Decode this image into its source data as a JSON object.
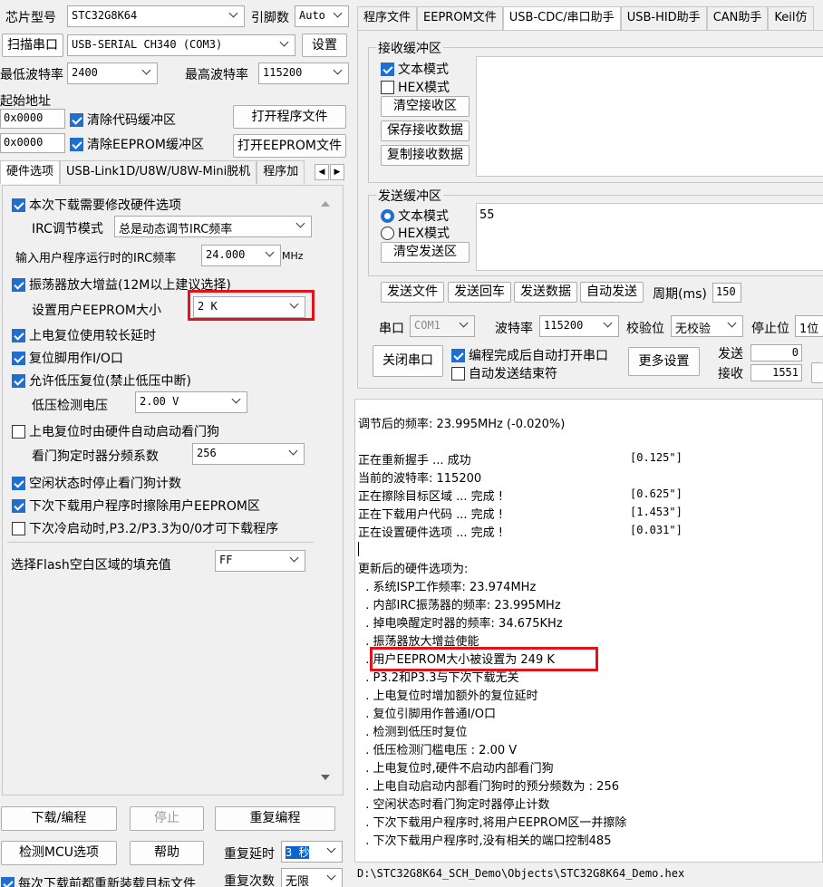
{
  "top": {
    "chip_label": "芯片型号",
    "chip_value": "STC32G8K64",
    "pin_label": "引脚数",
    "pin_value": "Auto",
    "scan_button": "扫描串口",
    "port_value": "USB-SERIAL CH340 (COM3)",
    "settings_button": "设置",
    "min_baud_label": "最低波特率",
    "min_baud_value": "2400",
    "max_baud_label": "最高波特率",
    "max_baud_value": "115200",
    "start_addr_label": "起始地址",
    "code_addr_value": "0x0000",
    "clear_code_label": "清除代码缓冲区",
    "open_program_button": "打开程序文件",
    "eeprom_addr_value": "0x0000",
    "clear_eeprom_label": "清除EEPROM缓冲区",
    "open_eeprom_button": "打开EEPROM文件"
  },
  "left_tabs": [
    "硬件选项",
    "USB-Link1D/U8W/U8W-Mini脱机",
    "程序加"
  ],
  "hw": {
    "opt1": "本次下载需要修改硬件选项",
    "irc_mode_label": "IRC调节模式",
    "irc_mode_value": "总是动态调节IRC频率",
    "irc_freq_label": "输入用户程序运行时的IRC频率",
    "irc_freq_value": "24.000",
    "irc_freq_unit": "MHz",
    "osc_gain": "振荡器放大增益(12M以上建议选择)",
    "eeprom_size_label": "设置用户EEPROM大小",
    "eeprom_size_value": "2   K",
    "power_delay": "上电复位使用较长延时",
    "reset_io": "复位脚用作I/O口",
    "lvr": "允许低压复位(禁止低压中断)",
    "lvd_label": "低压检测电压",
    "lvd_value": "2.00 V",
    "wdt_auto": "上电复位时由硬件自动启动看门狗",
    "wdt_div_label": "看门狗定时器分频系数",
    "wdt_div_value": "256",
    "idle_wdt": "空闲状态时停止看门狗计数",
    "erase_eeprom": "下次下载用户程序时擦除用户EEPROM区",
    "cold_boot": "下次冷启动时,P3.2/P3.3为0/0才可下载程序",
    "fill_label": "选择Flash空白区域的填充值",
    "fill_value": "FF"
  },
  "bottom_left": {
    "download_button": "下载/编程",
    "stop_button": "停止",
    "reprogram_button": "重复编程",
    "detect_button": "检测MCU选项",
    "help_button": "帮助",
    "repeat_delay_label": "重复延时",
    "repeat_delay_value": "3 秒",
    "repeat_count_label": "重复次数",
    "repeat_count_value": "无限",
    "reload_label": "每次下载前都重新装载目标文件"
  },
  "right_tabs": [
    "程序文件",
    "EEPROM文件",
    "USB-CDC/串口助手",
    "USB-HID助手",
    "CAN助手",
    "Keil仿"
  ],
  "serial": {
    "recv_group": "接收缓冲区",
    "recv_text_mode": "文本模式",
    "recv_hex_mode": "HEX模式",
    "clear_recv_button": "清空接收区",
    "save_recv_button": "保存接收数据",
    "copy_recv_button": "复制接收数据",
    "send_group": "发送缓冲区",
    "send_text_mode": "文本模式",
    "send_hex_mode": "HEX模式",
    "clear_send_button": "清空发送区",
    "send_content": "55",
    "send_file_button": "发送文件",
    "send_enter_button": "发送回车",
    "send_data_button": "发送数据",
    "auto_send_button": "自动发送",
    "period_label": "周期(ms)",
    "period_value": "150",
    "port_label": "串口",
    "port_value": "COM1",
    "baud_label": "波特率",
    "baud_value": "115200",
    "parity_label": "校验位",
    "parity_value": "无校验",
    "stop_label": "停止位",
    "stop_value": "1位",
    "close_port_button": "关闭串口",
    "auto_open_label": "编程完成后自动打开串口",
    "auto_end_label": "自动发送结束符",
    "more_settings_button": "更多设置",
    "tx_label": "发送",
    "tx_value": "0",
    "rx_label": "接收",
    "rx_value": "1551"
  },
  "log": {
    "lines": [
      {
        "text": "调节后的频率: 23.995MHz (-0.020%)",
        "time": ""
      },
      {
        "text": "",
        "time": ""
      },
      {
        "text": "正在重新握手 ... 成功",
        "time": "[0.125\"]"
      },
      {
        "text": "当前的波特率: 115200",
        "time": ""
      },
      {
        "text": "正在擦除目标区域 ... 完成 !",
        "time": "[0.625\"]"
      },
      {
        "text": "正在下载用户代码 ... 完成 !",
        "time": "[1.453\"]"
      },
      {
        "text": "正在设置硬件选项 ... 完成 !",
        "time": "[0.031\"]"
      },
      {
        "text": "",
        "time": ""
      },
      {
        "text": "更新后的硬件选项为:",
        "time": ""
      },
      {
        "text": "  . 系统ISP工作频率: 23.974MHz",
        "time": ""
      },
      {
        "text": "  . 内部IRC振荡器的频率: 23.995MHz",
        "time": ""
      },
      {
        "text": "  . 掉电唤醒定时器的频率: 34.675KHz",
        "time": ""
      },
      {
        "text": "  . 振荡器放大增益使能",
        "time": ""
      },
      {
        "text": "  . 用户EEPROM大小被设置为 249 K",
        "time": ""
      },
      {
        "text": "  . P3.2和P3.3与下次下载无关",
        "time": ""
      },
      {
        "text": "  . 上电复位时增加额外的复位延时",
        "time": ""
      },
      {
        "text": "  . 复位引脚用作普通I/O口",
        "time": ""
      },
      {
        "text": "  . 检测到低压时复位",
        "time": ""
      },
      {
        "text": "  . 低压检测门槛电压 : 2.00 V",
        "time": ""
      },
      {
        "text": "  . 上电复位时,硬件不启动内部看门狗",
        "time": ""
      },
      {
        "text": "  . 上电自动启动内部看门狗时的预分频数为 : 256",
        "time": ""
      },
      {
        "text": "  . 空闲状态时看门狗定时器停止计数",
        "time": ""
      },
      {
        "text": "  . 下次下载用户程序时,将用户EEPROM区一并擦除",
        "time": ""
      },
      {
        "text": "  . 下次下载用户程序时,没有相关的端口控制485",
        "time": ""
      }
    ]
  },
  "status_path": "D:\\STC32G8K64_SCH_Demo\\Objects\\STC32G8K64_Demo.hex",
  "colors": {
    "accent": "#1f6fd2",
    "highlight_box": "#e1141c"
  }
}
